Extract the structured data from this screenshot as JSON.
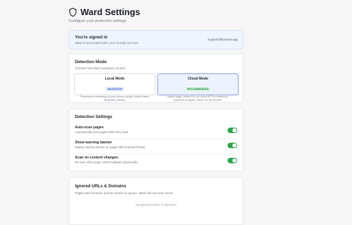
{
  "header": {
    "title": "Ward Settings",
    "subtitle": "Configure your protection settings",
    "icon": "shield-icon"
  },
  "signin": {
    "heading": "You're signed in",
    "description": "Ward is associated with your Google account",
    "email": "support@tryward.app"
  },
  "detection_mode": {
    "title": "Detection Mode",
    "description": "Choose how Ward analyzes content",
    "options": [
      {
        "label": "Local Mode",
        "badge": "ON-DEVICE",
        "description": "Processes everything on your device using Gemini Nano. Maximum privacy.",
        "selected": false
      },
      {
        "label": "Cloud Mode",
        "badge": "RECOMMENDED",
        "description": "Sends page content to our cloud API for instant AI-powered analysis. Works on all devices.",
        "selected": true
      }
    ]
  },
  "detection_settings": {
    "title": "Detection Settings",
    "items": [
      {
        "label": "Auto-scan pages",
        "description": "Automatically scan pages when they load",
        "enabled": true
      },
      {
        "label": "Show warning banner",
        "description": "Display warning banner on pages with detected threats",
        "enabled": true
      },
      {
        "label": "Scan on content changes",
        "description": "Re-scan when page content updates dynamically",
        "enabled": true
      }
    ]
  },
  "ignored": {
    "title": "Ignored URLs & Domains",
    "description": "Pages and domains you've chosen to ignore. Ward will not scan these.",
    "empty_text": "No ignored URLs or domains"
  },
  "colors": {
    "accent": "#2da44e",
    "selected_border": "#8f9ae0",
    "signed_bg": "#f0f4ff"
  }
}
